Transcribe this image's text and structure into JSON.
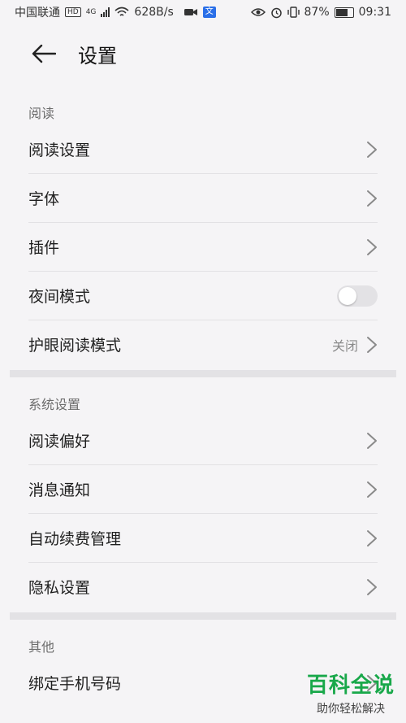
{
  "status_bar": {
    "carrier": "中国联通",
    "hd": "HD",
    "network": "4G",
    "speed": "628B/s",
    "battery": "87%",
    "battery_level": 0.87,
    "time": "09:31",
    "app_badge": "文"
  },
  "header": {
    "title": "设置"
  },
  "sections": [
    {
      "label": "阅读",
      "items": [
        {
          "label": "阅读设置",
          "type": "link"
        },
        {
          "label": "字体",
          "type": "link"
        },
        {
          "label": "插件",
          "type": "link"
        },
        {
          "label": "夜间模式",
          "type": "toggle",
          "on": false
        },
        {
          "label": "护眼阅读模式",
          "type": "link",
          "value": "关闭"
        }
      ]
    },
    {
      "label": "系统设置",
      "items": [
        {
          "label": "阅读偏好",
          "type": "link"
        },
        {
          "label": "消息通知",
          "type": "link"
        },
        {
          "label": "自动续费管理",
          "type": "link"
        },
        {
          "label": "隐私设置",
          "type": "link"
        }
      ]
    },
    {
      "label": "其他",
      "items": [
        {
          "label": "绑定手机号码",
          "type": "link"
        }
      ]
    }
  ],
  "watermark": {
    "title": "百科全说",
    "subtitle": "助你轻松解决"
  },
  "colors": {
    "background": "#f5f4f6",
    "divider": "#e3e2e5",
    "watermark": "#19a84a"
  }
}
